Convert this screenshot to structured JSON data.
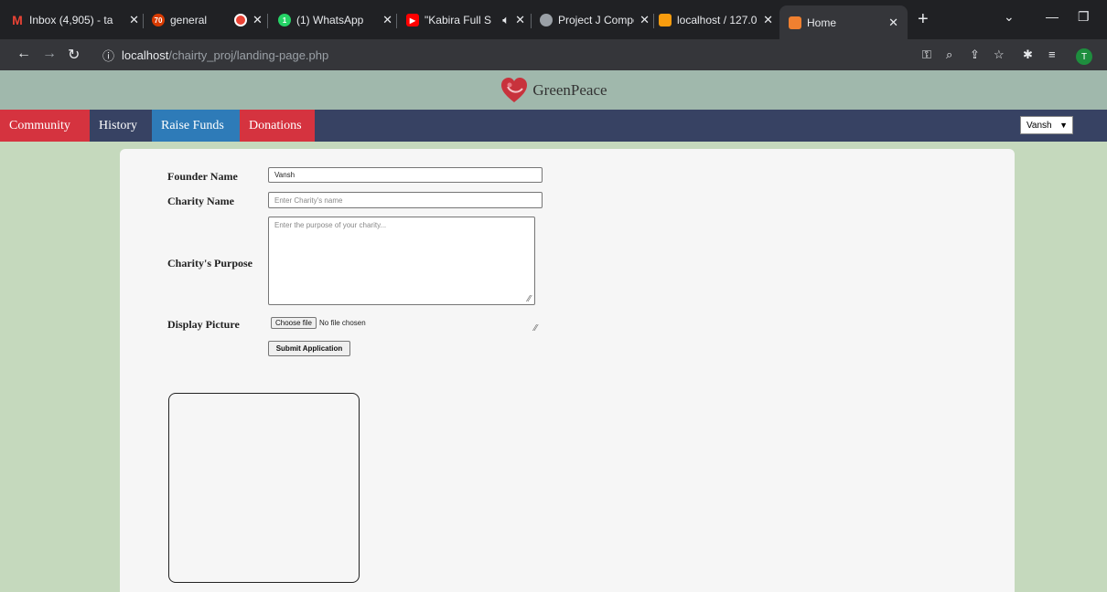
{
  "browser": {
    "tabs": [
      {
        "title": "Inbox (4,905) - ta",
        "icon": "gmail-icon",
        "color": "#ea4335"
      },
      {
        "title": "general",
        "icon": "chat-icon",
        "color": "#d83b01",
        "badge": "70"
      },
      {
        "title": "",
        "icon": "record-icon",
        "color": "#ea4335"
      },
      {
        "title": "(1) WhatsApp",
        "icon": "whatsapp-icon",
        "color": "#25d366"
      },
      {
        "title": "\"Kabira Full S",
        "icon": "youtube-icon",
        "color": "#ff0000"
      },
      {
        "title": "Project J Compo",
        "icon": "globe-icon",
        "color": "#9aa0a6"
      },
      {
        "title": "localhost / 127.0",
        "icon": "phpmyadmin-icon",
        "color": "#f89c0e"
      },
      {
        "title": "Home",
        "icon": "site-icon",
        "color": "#f08030"
      }
    ],
    "url_host": "localhost",
    "url_path": "/chairty_proj/landing-page.php",
    "profile_initial": "T"
  },
  "site": {
    "brand": "GreenPeace",
    "nav": [
      {
        "label": "Community"
      },
      {
        "label": "History"
      },
      {
        "label": "Raise Funds"
      },
      {
        "label": "Donations"
      }
    ],
    "user_select": "Vansh"
  },
  "form": {
    "founder_label": "Founder Name",
    "founder_value": "Vansh",
    "charity_label": "Charity Name",
    "charity_placeholder": "Enter Charity's name",
    "purpose_label": "Charity's Purpose",
    "purpose_placeholder": "Enter the purpose of your charity...",
    "picture_label": "Display Picture",
    "choose_file": "Choose file",
    "no_file": "No file chosen",
    "submit": "Submit Application"
  },
  "colors": {
    "nav_bg": "#374263",
    "nav_red": "#d5333f",
    "nav_blue": "#2e7bb8",
    "page_bg": "#c5d9bd",
    "header_bg": "#a0b8ac"
  }
}
